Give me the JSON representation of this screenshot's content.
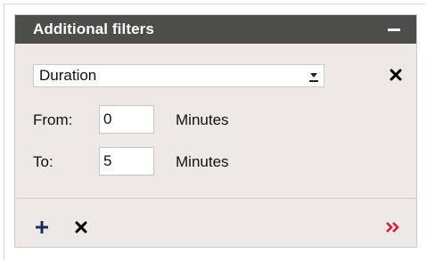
{
  "panel": {
    "title": "Additional filters"
  },
  "filter": {
    "field": "Duration",
    "from_label": "From:",
    "from_value": "0",
    "from_unit": "Minutes",
    "to_label": "To:",
    "to_value": "5",
    "to_unit": "Minutes"
  },
  "colors": {
    "header_bg": "#4d4d4b",
    "panel_bg": "#ece9e6",
    "add_icon": "#1f2d5c",
    "more_icon": "#d21f3c"
  },
  "icons": {
    "collapse": "minus-icon",
    "remove": "close-icon",
    "add": "plus-icon",
    "clear": "close-icon",
    "more": "double-chevron-right-icon"
  }
}
